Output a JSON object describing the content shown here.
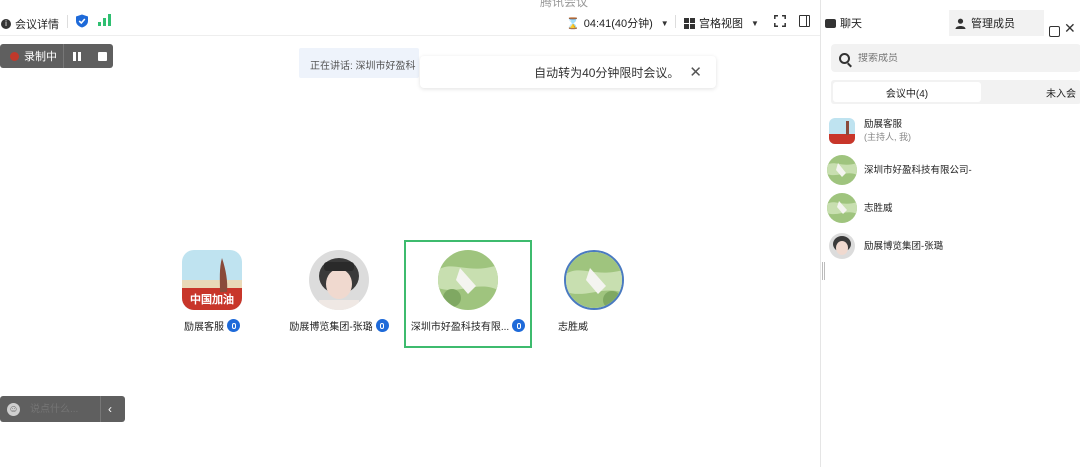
{
  "window": {
    "title": "腾讯会议"
  },
  "topbar": {
    "meeting_info_label": "会议详情",
    "timer": "04:41(40分钟)",
    "view_label": "宫格视图"
  },
  "recording": {
    "label": "录制中"
  },
  "speaking": {
    "text": "正在讲话: 深圳市好盈科"
  },
  "notice": {
    "text": "自动转为40分钟限时会议。"
  },
  "participants": [
    {
      "name": "励展客服",
      "badge_text": "中国加油"
    },
    {
      "name": "励展博览集团-张璐"
    },
    {
      "name": "深圳市好盈科技有限..."
    },
    {
      "name": "志胜威"
    }
  ],
  "chat_input": {
    "placeholder": "说点什么..."
  },
  "panel": {
    "tab_chat": "聊天",
    "tab_members": "管理成员",
    "search_placeholder": "搜索成员",
    "in_meeting": "会议中(4)",
    "not_joined": "未入会",
    "members": [
      {
        "name": "励展客服",
        "role": "(主持人, 我)"
      },
      {
        "name": "深圳市好盈科技有限公司-"
      },
      {
        "name": "志胜威"
      },
      {
        "name": "励展博览集团-张璐"
      }
    ]
  },
  "colors": {
    "accent": "#1e6ad9",
    "active_border": "#3dbb6e",
    "signal": "#2fbf71"
  }
}
